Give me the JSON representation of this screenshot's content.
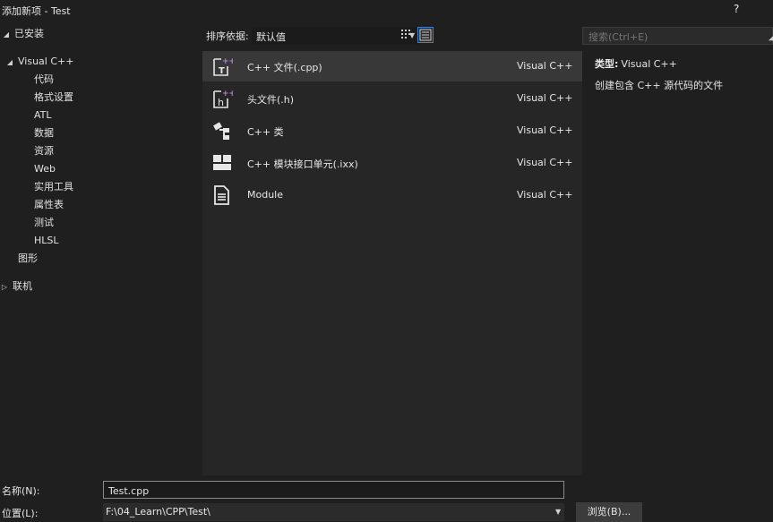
{
  "window": {
    "title": "添加新项 - Test",
    "help": "?"
  },
  "tree": {
    "installed": "已安装",
    "visual_cpp": "Visual C++",
    "children": [
      "代码",
      "格式设置",
      "ATL",
      "数据",
      "资源",
      "Web",
      "实用工具",
      "属性表",
      "测试",
      "HLSL"
    ],
    "graphics": "图形",
    "online": "联机"
  },
  "toolbar": {
    "sort_label": "排序依据:",
    "sort_value": "默认值"
  },
  "search": {
    "placeholder": "搜索(Ctrl+E)"
  },
  "templates": [
    {
      "name": "C++ 文件(.cpp)",
      "lang": "Visual C++",
      "icon": "cpp-file-icon",
      "selected": true
    },
    {
      "name": "头文件(.h)",
      "lang": "Visual C++",
      "icon": "header-file-icon",
      "selected": false
    },
    {
      "name": "C++ 类",
      "lang": "Visual C++",
      "icon": "class-icon",
      "selected": false
    },
    {
      "name": "C++ 模块接口单元(.ixx)",
      "lang": "Visual C++",
      "icon": "module-interface-icon",
      "selected": false
    },
    {
      "name": "Module",
      "lang": "Visual C++",
      "icon": "module-doc-icon",
      "selected": false
    }
  ],
  "detail": {
    "type_label": "类型:",
    "type_value": "Visual C++",
    "description": "创建包含 C++ 源代码的文件"
  },
  "form": {
    "name_label": "名称(N):",
    "name_value": "Test.cpp",
    "location_label": "位置(L):",
    "location_value": "F:\\04_Learn\\CPP\\Test\\",
    "browse_label": "浏览(B)..."
  },
  "colors": {
    "accent": "#3f7fd0",
    "selected_row": "#383838",
    "list_bg": "#262626",
    "window_bg": "#1f1f1f",
    "plus_badge": "#b180d7"
  }
}
